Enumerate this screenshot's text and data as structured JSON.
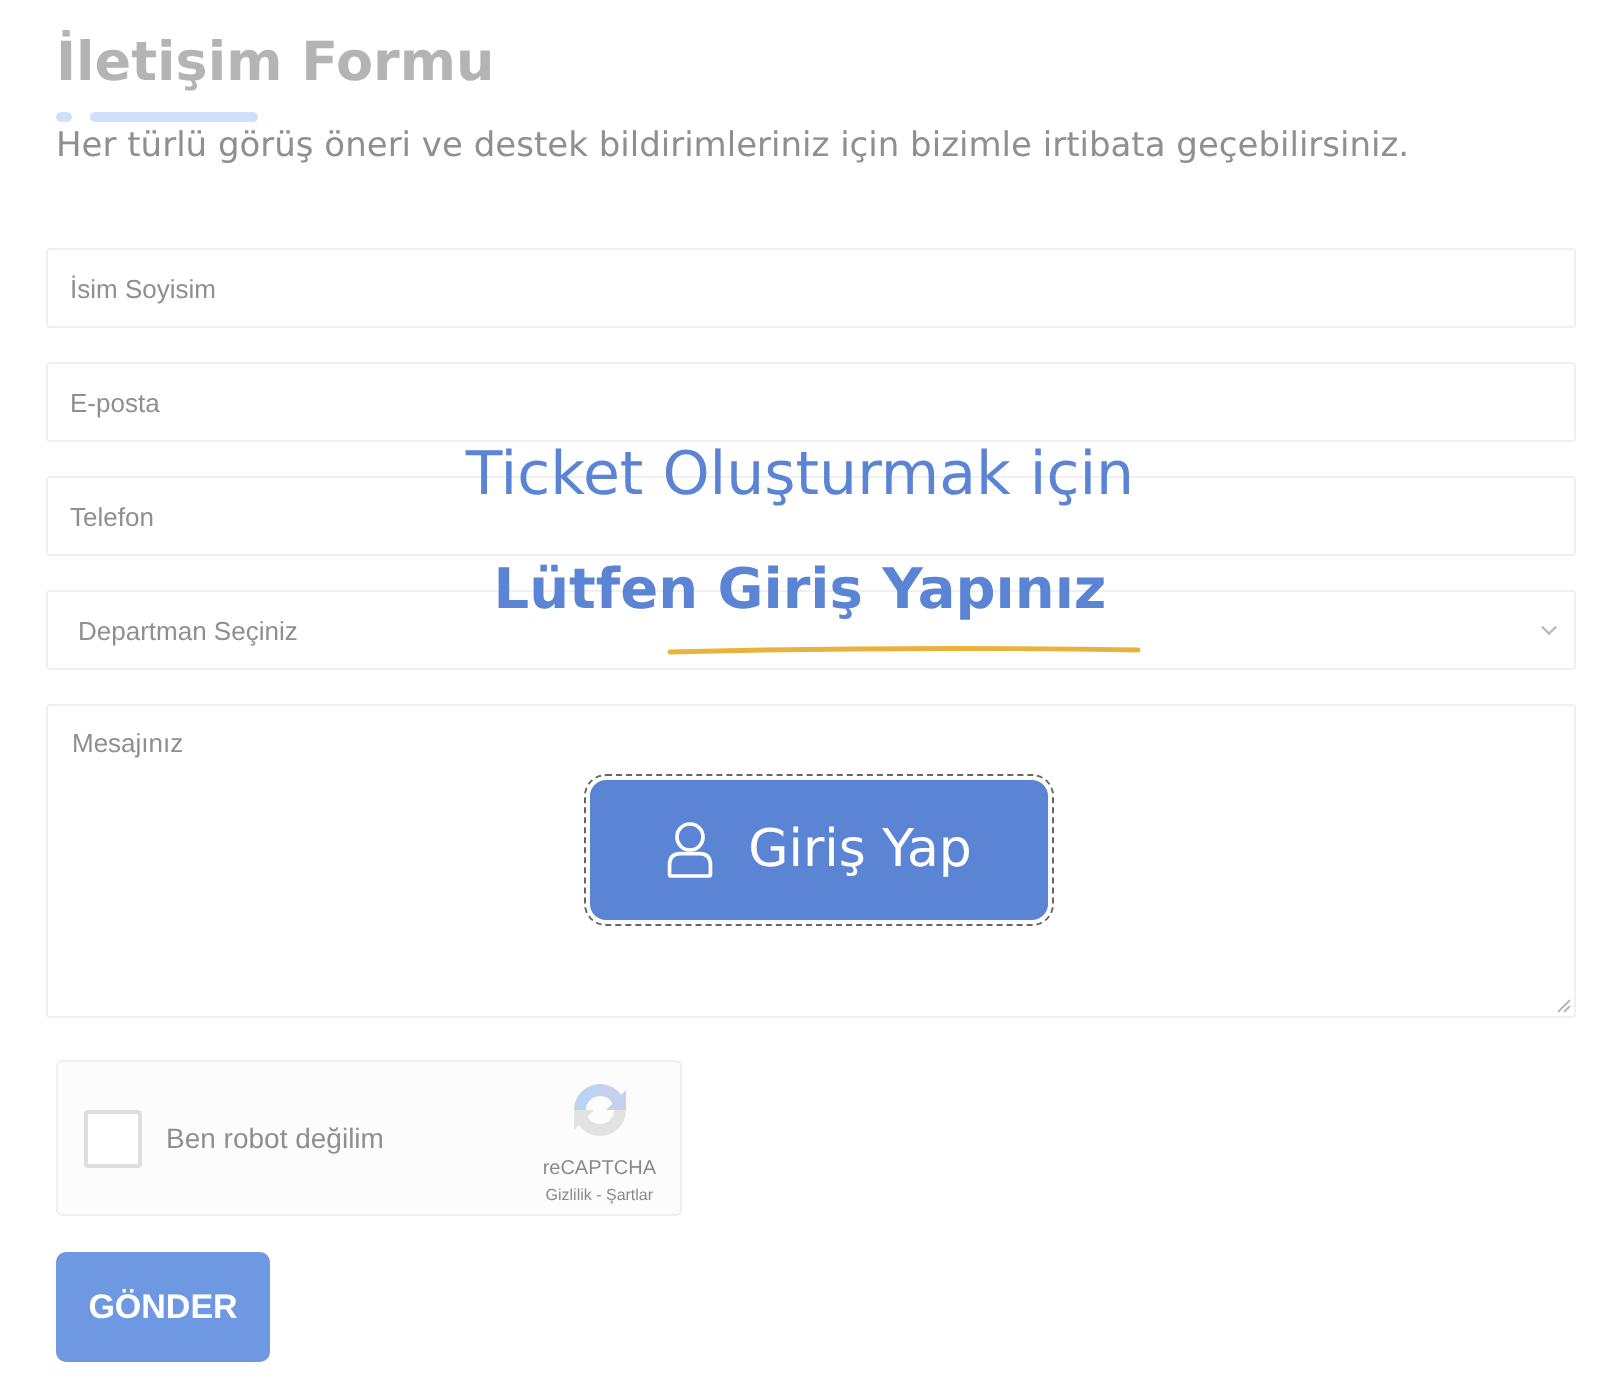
{
  "header": {
    "title": "İletişim Formu",
    "subtitle": "Her türlü görüş öneri ve destek bildirimleriniz için bizimle irtibata geçebilirsiniz."
  },
  "form": {
    "disabled": true,
    "fields": [
      {
        "kind": "input",
        "placeholder": "İsim Soyisim"
      },
      {
        "kind": "input",
        "placeholder": "E-posta"
      },
      {
        "kind": "input",
        "placeholder": "Telefon"
      },
      {
        "kind": "select",
        "placeholder": "Departman Seçiniz"
      },
      {
        "kind": "textarea",
        "placeholder": "Mesajınız"
      }
    ],
    "captcha": {
      "checked": false,
      "label": "Ben robot değilim",
      "brand": "reCAPTCHA",
      "links": "Gizlilik - Şartlar"
    },
    "submit": {
      "label": "GÖNDER"
    }
  },
  "login_prompt": {
    "line_1": "Ticket Oluşturmak için",
    "line_2": "Lütfen Giriş Yapınız",
    "button": {
      "label": "Giriş Yap",
      "focused": true
    }
  }
}
